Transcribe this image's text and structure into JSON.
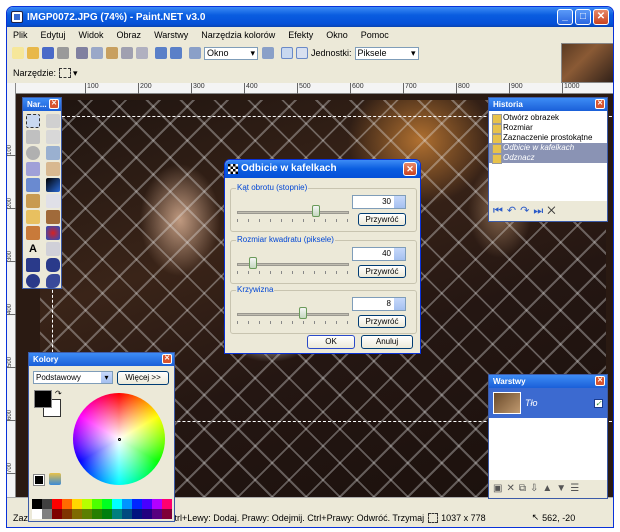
{
  "window": {
    "title": "IMGP0072.JPG (74%) - Paint.NET v3.0"
  },
  "menu": [
    "Plik",
    "Edytuj",
    "Widok",
    "Obraz",
    "Warstwy",
    "Narzędzia kolorów",
    "Efekty",
    "Okno",
    "Pomoc"
  ],
  "toolbar": {
    "zoom_value": "Okno",
    "units_label": "Jednostki:",
    "units_value": "Piksele",
    "tool_label": "Narzędzie:"
  },
  "ruler": {
    "h": [
      "px",
      "100",
      "200",
      "300",
      "400",
      "500",
      "600",
      "700",
      "800",
      "900",
      "1000"
    ],
    "v": [
      "100",
      "200",
      "300",
      "400",
      "500",
      "600",
      "700"
    ]
  },
  "tools_panel": {
    "title": "Nar..."
  },
  "colors_panel": {
    "title": "Kolory",
    "mode": "Podstawowy",
    "more_btn": "Więcej >>"
  },
  "history_panel": {
    "title": "Historia",
    "items": [
      "Otwórz obrazek",
      "Rozmiar",
      "Zaznaczenie prostokątne",
      "Odbicie w kafelkach",
      "Odznacz"
    ]
  },
  "layers_panel": {
    "title": "Warstwy",
    "layer": "Tło"
  },
  "dialog": {
    "title": "Odbicie w kafelkach",
    "angle_label": "Kąt obrotu (stopnie)",
    "angle_value": "30",
    "angle_level": 0.72,
    "size_label": "Rozmiar kwadratu (piksele)",
    "size_value": "40",
    "size_level": 0.12,
    "curv_label": "Krzywizna",
    "curv_value": "8",
    "curv_level": 0.6,
    "reset": "Przywróć",
    "ok": "OK",
    "cancel": "Anuluj"
  },
  "status": {
    "hint": "Zaz",
    "hint2": "cz. Ctrl+Lewy: Dodaj. Prawy: Odejmij. Ctrl+Prawy: Odwróć. Trzymaj",
    "size": "1037 x 778",
    "coords": "562, -20"
  }
}
